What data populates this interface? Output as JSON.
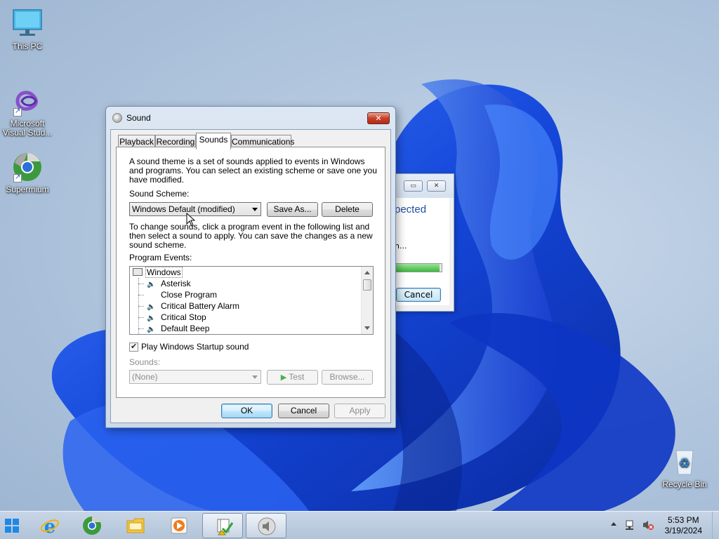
{
  "desktop": {
    "icons": [
      {
        "label": "This PC",
        "icon": "monitor-icon"
      },
      {
        "label": "Microsoft Visual Stud...",
        "icon": "visual-studio-icon"
      },
      {
        "label": "Supermium",
        "icon": "supermium-browser-icon"
      },
      {
        "label": "Recycle Bin",
        "icon": "recycle-bin-icon"
      }
    ]
  },
  "background_window": {
    "heading_fragment": "pected",
    "status_fragment": "n...",
    "progress": 0.95,
    "cancel_label": "Cancel",
    "minimize_glyph": "▭",
    "close_glyph": "✕"
  },
  "dialog": {
    "title": "Sound",
    "close_glyph": "✕",
    "tabs": [
      {
        "label": "Playback",
        "active": false
      },
      {
        "label": "Recording",
        "active": false
      },
      {
        "label": "Sounds",
        "active": true
      },
      {
        "label": "Communications",
        "active": false
      }
    ],
    "intro_text": "A sound theme is a set of sounds applied to events in Windows and programs.  You can select an existing scheme or save one you have modified.",
    "intro_lines": [
      "A sound theme is a set of sounds applied to events in Windows",
      "and programs.  You can select an existing scheme or save one you",
      "have modified."
    ],
    "scheme_label": "Sound Scheme:",
    "scheme_value": "Windows Default (modified)",
    "save_as_label": "Save As...",
    "delete_label": "Delete",
    "instructions_lines": [
      "To change sounds, click a program event in the following list and",
      "then select a sound to apply.  You can save the changes as a new",
      "sound scheme."
    ],
    "program_events_label": "Program Events:",
    "events": {
      "group": "Windows",
      "items": [
        {
          "label": "Asterisk",
          "has_sound": true
        },
        {
          "label": "Close Program",
          "has_sound": false
        },
        {
          "label": "Critical Battery Alarm",
          "has_sound": true
        },
        {
          "label": "Critical Stop",
          "has_sound": true
        },
        {
          "label": "Default Beep",
          "has_sound": true
        }
      ]
    },
    "startup_checkbox_label": "Play Windows Startup sound",
    "startup_checked": true,
    "sounds_label": "Sounds:",
    "sounds_value": "(None)",
    "test_label": "Test",
    "browse_label": "Browse...",
    "ok_label": "OK",
    "cancel_label": "Cancel",
    "apply_label": "Apply"
  },
  "taskbar": {
    "items": [
      {
        "icon": "start-windows-icon"
      },
      {
        "icon": "internet-explorer-icon"
      },
      {
        "icon": "supermium-browser-icon"
      },
      {
        "icon": "file-explorer-icon"
      },
      {
        "icon": "media-player-icon"
      },
      {
        "icon": "action-center-flag-icon",
        "active": true
      },
      {
        "icon": "speaker-icon",
        "active": true
      }
    ],
    "time": "5:53 PM",
    "date": "3/19/2024"
  },
  "colors": {
    "accent": "#1e4fa3",
    "close_red": "#c7402a",
    "wallpaper_blue": "#1c4fe0"
  }
}
